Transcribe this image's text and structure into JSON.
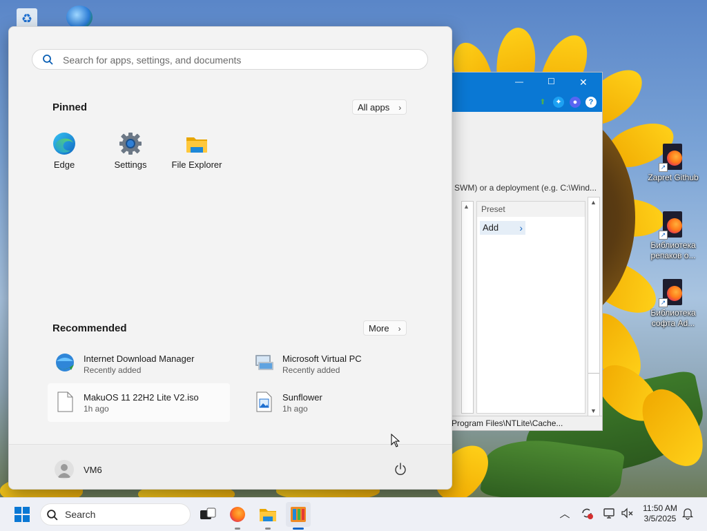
{
  "desktop": {
    "icons": [
      {
        "label": "Zapret Github",
        "icon": "firefox-shortcut-icon"
      },
      {
        "label": "Библиотека репаков о...",
        "icon": "firefox-shortcut-icon"
      },
      {
        "label": "Библиотека софта Ad...",
        "icon": "firefox-shortcut-icon"
      }
    ],
    "wallpaper": "sunflower"
  },
  "ntlite": {
    "title_buttons": {
      "minimize": "—",
      "maximize": "☐",
      "close": "✕"
    },
    "path_hint": "SWM) or a deployment (e.g. C:\\Wind...",
    "preset_header": "Preset",
    "add_label": "Add",
    "status_text": "Program Files\\NTLite\\Cache..."
  },
  "start_menu": {
    "search_placeholder": "Search for apps, settings, and documents",
    "pinned_title": "Pinned",
    "all_apps_label": "All apps",
    "pinned": [
      {
        "label": "Edge",
        "icon": "edge-icon"
      },
      {
        "label": "Settings",
        "icon": "settings-gear-icon"
      },
      {
        "label": "File Explorer",
        "icon": "file-explorer-icon"
      }
    ],
    "recommended_title": "Recommended",
    "more_label": "More",
    "recommended": [
      {
        "title": "Internet Download Manager",
        "subtitle": "Recently added",
        "icon": "idm-icon"
      },
      {
        "title": "Microsoft Virtual PC",
        "subtitle": "Recently added",
        "icon": "virtual-pc-icon"
      },
      {
        "title": "MakuOS 11 22H2 Lite V2.iso",
        "subtitle": "1h ago",
        "icon": "document-icon"
      },
      {
        "title": "Sunflower",
        "subtitle": "1h ago",
        "icon": "image-file-icon"
      }
    ],
    "user_name": "VM6"
  },
  "taskbar": {
    "search_label": "Search",
    "time": "11:50 AM",
    "date": "3/5/2025"
  },
  "colors": {
    "accent": "#0a78d4",
    "start_bg": "#f3f3f3",
    "taskbar_bg": "#eef0f6"
  }
}
